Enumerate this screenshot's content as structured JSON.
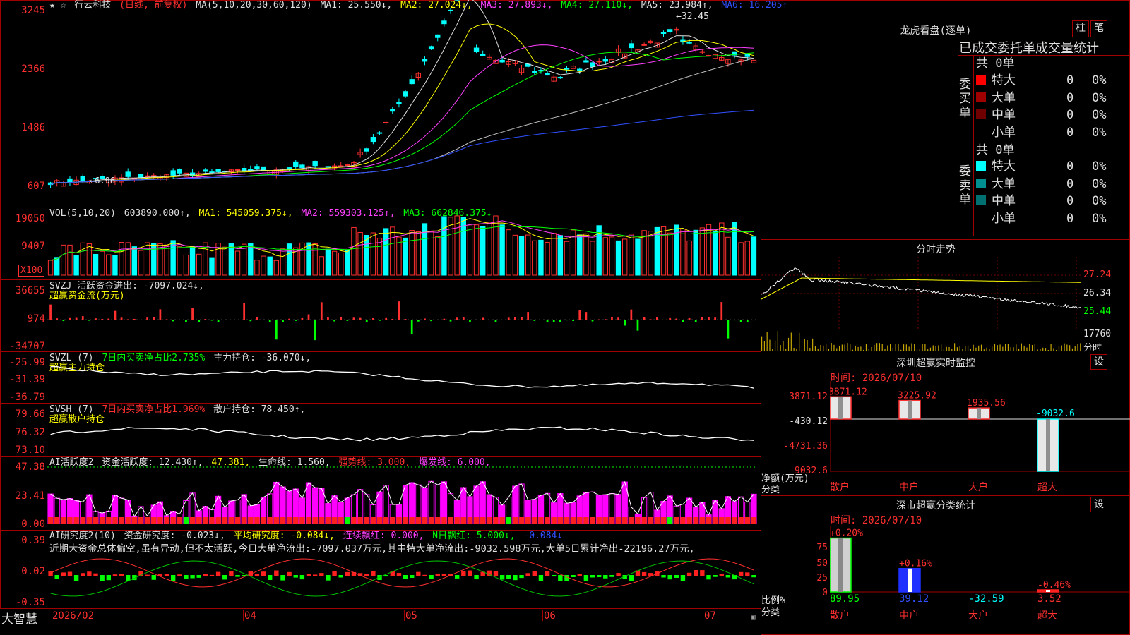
{
  "stock": {
    "name": "行云科技",
    "period_tag": "(日线, 前复权)",
    "stars": "★ ☆"
  },
  "price_panel": {
    "ma_label": "MA(5,10,20,30,60,120)",
    "ma1": "MA1: 25.550↓,",
    "ma2": "MA2: 27.024↓,",
    "ma3": "MA3: 27.893↓,",
    "ma4": "MA4: 27.110↓,",
    "ma5": "MA5: 23.984↑,",
    "ma6": "MA6: 16.205↑",
    "axis": [
      "3245",
      "2366",
      "1486",
      "607"
    ],
    "high_mark": "32.45",
    "low_mark": "6.96"
  },
  "vol_panel": {
    "label": "VOL(5,10,20)",
    "value": "603890.000↑,",
    "ma1": "MA1: 545059.375↓,",
    "ma2": "MA2: 559303.125↑,",
    "ma3": "MA3: 662846.375↓",
    "axis": [
      "19050",
      "9407"
    ],
    "unit": "X100"
  },
  "svzj_panel": {
    "label": "SVZJ  活跃资金进出: -7097.024↓,",
    "sub": "超赢资金流(万元)",
    "axis": [
      "36655",
      "974",
      "-34707"
    ]
  },
  "svzl_panel": {
    "label": "SVZL (7)",
    "ratio": "7日内买卖净占比2.735%",
    "main": "主力持仓: -36.070↓,",
    "sub": "超赢主力持仓",
    "axis": [
      "-25.99",
      "-31.39",
      "-36.79"
    ]
  },
  "svsh_panel": {
    "label": "SVSH (7)",
    "ratio": "7日内买卖净占比1.969%",
    "retail": "散户持仓: 78.450↑,",
    "sub": "超赢散户持仓",
    "axis": [
      "79.66",
      "76.32",
      "73.10"
    ]
  },
  "ai_active_panel": {
    "label": "AI活跃度2",
    "activity": "资金活跃度: 12.430↑,",
    "v2": "47.381,",
    "life": "生命线: 1.560,",
    "strong": "强势线: 3.000,",
    "burst": "爆发线: 6.000,",
    "axis": [
      "47.38",
      "23.41",
      "0.00"
    ]
  },
  "ai_research_panel": {
    "label": "AI研究度2(10)",
    "research": "资金研究度: -0.023↓,",
    "avg": "平均研究度: -0.084↓,",
    "cont": "连续飘红: 0.000,",
    "nday": "N日飘红: 5.000↓,",
    "last": "-0.084↓",
    "comment": "近期大资金总体偏空,虽有异动,但不太活跃,今日大单净流出:-7097.037万元,其中特大单净流出:-9032.598万元,大单5日累计净出-22196.27万元,",
    "axis": [
      "0.39",
      "0.02",
      "-0.35"
    ]
  },
  "x_axis": {
    "app_name": "大智慧",
    "labels": [
      "2026/02",
      "04",
      "05",
      "06",
      "07"
    ]
  },
  "dragon_tiger": {
    "title": "龙虎看盘(逐单)",
    "btn_bar": "柱",
    "btn_pen": "笔",
    "header": "已成交委托单成交量统计",
    "buy_side": "委买单",
    "sell_side": "委卖单",
    "buy_total": "共 0单",
    "sell_total": "共 0单",
    "buy_rows": [
      {
        "label": "特大",
        "count": "0",
        "pct": "0%",
        "color": "#ff0000"
      },
      {
        "label": "大单",
        "count": "0",
        "pct": "0%",
        "color": "#a00000"
      },
      {
        "label": "中单",
        "count": "0",
        "pct": "0%",
        "color": "#700000"
      },
      {
        "label": "小单",
        "count": "0",
        "pct": "0%",
        "color": "#000000"
      }
    ],
    "sell_rows": [
      {
        "label": "特大",
        "count": "0",
        "pct": "0%",
        "color": "#00ffff"
      },
      {
        "label": "大单",
        "count": "0",
        "pct": "0%",
        "color": "#009090"
      },
      {
        "label": "中单",
        "count": "0",
        "pct": "0%",
        "color": "#007070"
      },
      {
        "label": "小单",
        "count": "0",
        "pct": "0%",
        "color": "#000000"
      }
    ]
  },
  "intraday": {
    "title": "分时走势",
    "axis": [
      "27.24",
      "26.34",
      "25.44",
      "17760",
      "分时"
    ]
  },
  "sz_monitor": {
    "title": "深圳超赢实时监控",
    "btn": "设",
    "time": "时间: 2026/07/10",
    "axis": [
      "3871.12",
      "-430.12",
      "-4731.36",
      "-9032.6"
    ],
    "net_label": "净额(万元)",
    "cat_label": "分类",
    "categories": [
      "散户",
      "中户",
      "大户",
      "超大"
    ],
    "values": [
      "3871.12",
      "3225.92",
      "1935.56",
      "-9032.6"
    ]
  },
  "sz_class": {
    "title": "深市超赢分类统计",
    "btn": "设",
    "time": "时间: 2026/07/10",
    "axis": [
      "75",
      "50",
      "25",
      "0"
    ],
    "ratio_label": "比例%",
    "cat_label": "分类",
    "categories": [
      "散户",
      "中户",
      "大户",
      "超大"
    ],
    "changes": [
      "+0.20%",
      "+0.16%",
      "",
      "-0.46%"
    ],
    "values": [
      "89.95",
      "39.12",
      "-32.59",
      "3.52"
    ]
  }
}
